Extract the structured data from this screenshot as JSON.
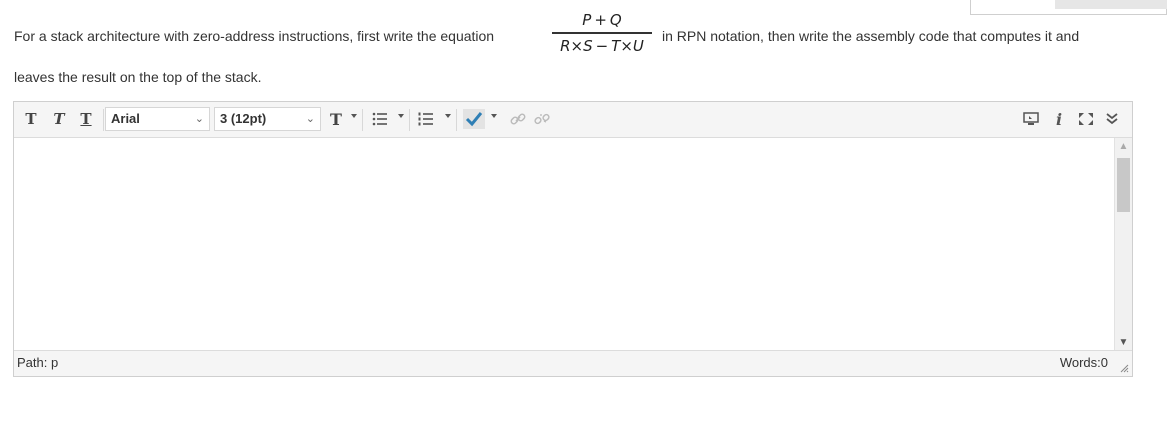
{
  "question": {
    "text_before": "For a stack architecture with zero-address instructions, first write the equation",
    "numerator": "P + Q",
    "denominator": "R×S − T×U",
    "text_after": "in RPN notation, then write the assembly code that computes it and",
    "text_line2": "leaves the result on the top of the stack."
  },
  "toolbar": {
    "font_family": "Arial",
    "font_size": "3 (12pt)",
    "icons": [
      "text-bold-icon",
      "text-italic-icon",
      "text-underline-icon",
      "text-color-icon",
      "bullet-list-icon",
      "numbered-list-icon",
      "spellcheck-icon",
      "link-icon",
      "unlink-icon",
      "preview-icon",
      "italic-info-icon",
      "fullscreen-icon",
      "collapse-icon"
    ]
  },
  "status": {
    "path": "Path: p",
    "words": "Words:0"
  }
}
